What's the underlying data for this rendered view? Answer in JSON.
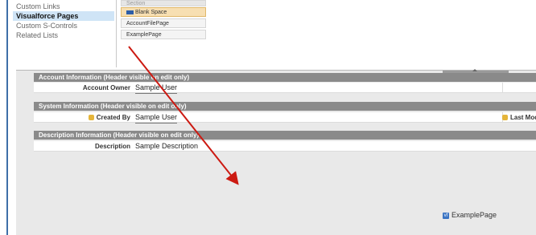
{
  "palette": {
    "categories": [
      {
        "label": "Custom Links",
        "selected": false
      },
      {
        "label": "Visualforce Pages",
        "selected": true
      },
      {
        "label": "Custom S-Controls",
        "selected": false
      },
      {
        "label": "Related Lists",
        "selected": false
      }
    ],
    "top_item": "Section",
    "items": [
      {
        "label": "Section",
        "highlighted": false
      },
      {
        "label": "Blank Space",
        "highlighted": true
      },
      {
        "label": "AccountFilePage",
        "highlighted": false
      },
      {
        "label": "ExamplePage",
        "highlighted": false
      }
    ]
  },
  "sections": [
    {
      "header": "Account Information (Header visible on edit only)",
      "rows": [
        {
          "label": "Account Owner",
          "value": "Sample User",
          "locked": false,
          "right_label": ""
        }
      ]
    },
    {
      "header": "System Information (Header visible on edit only)",
      "rows": [
        {
          "label": "Created By",
          "value": "Sample User",
          "locked": true,
          "right_label": "Last Modified By"
        }
      ]
    },
    {
      "header": "Description Information (Header visible on edit only)",
      "rows": [
        {
          "label": "Description",
          "value": "Sample Description",
          "locked": false,
          "right_label": ""
        }
      ]
    }
  ],
  "component": {
    "badge": "vf",
    "label": "ExamplePage"
  },
  "colors": {
    "frame": "#3f6fa8",
    "arrow": "#cc1a12",
    "selected": "#cfe4f6",
    "section_header": "#8a8a8a"
  }
}
